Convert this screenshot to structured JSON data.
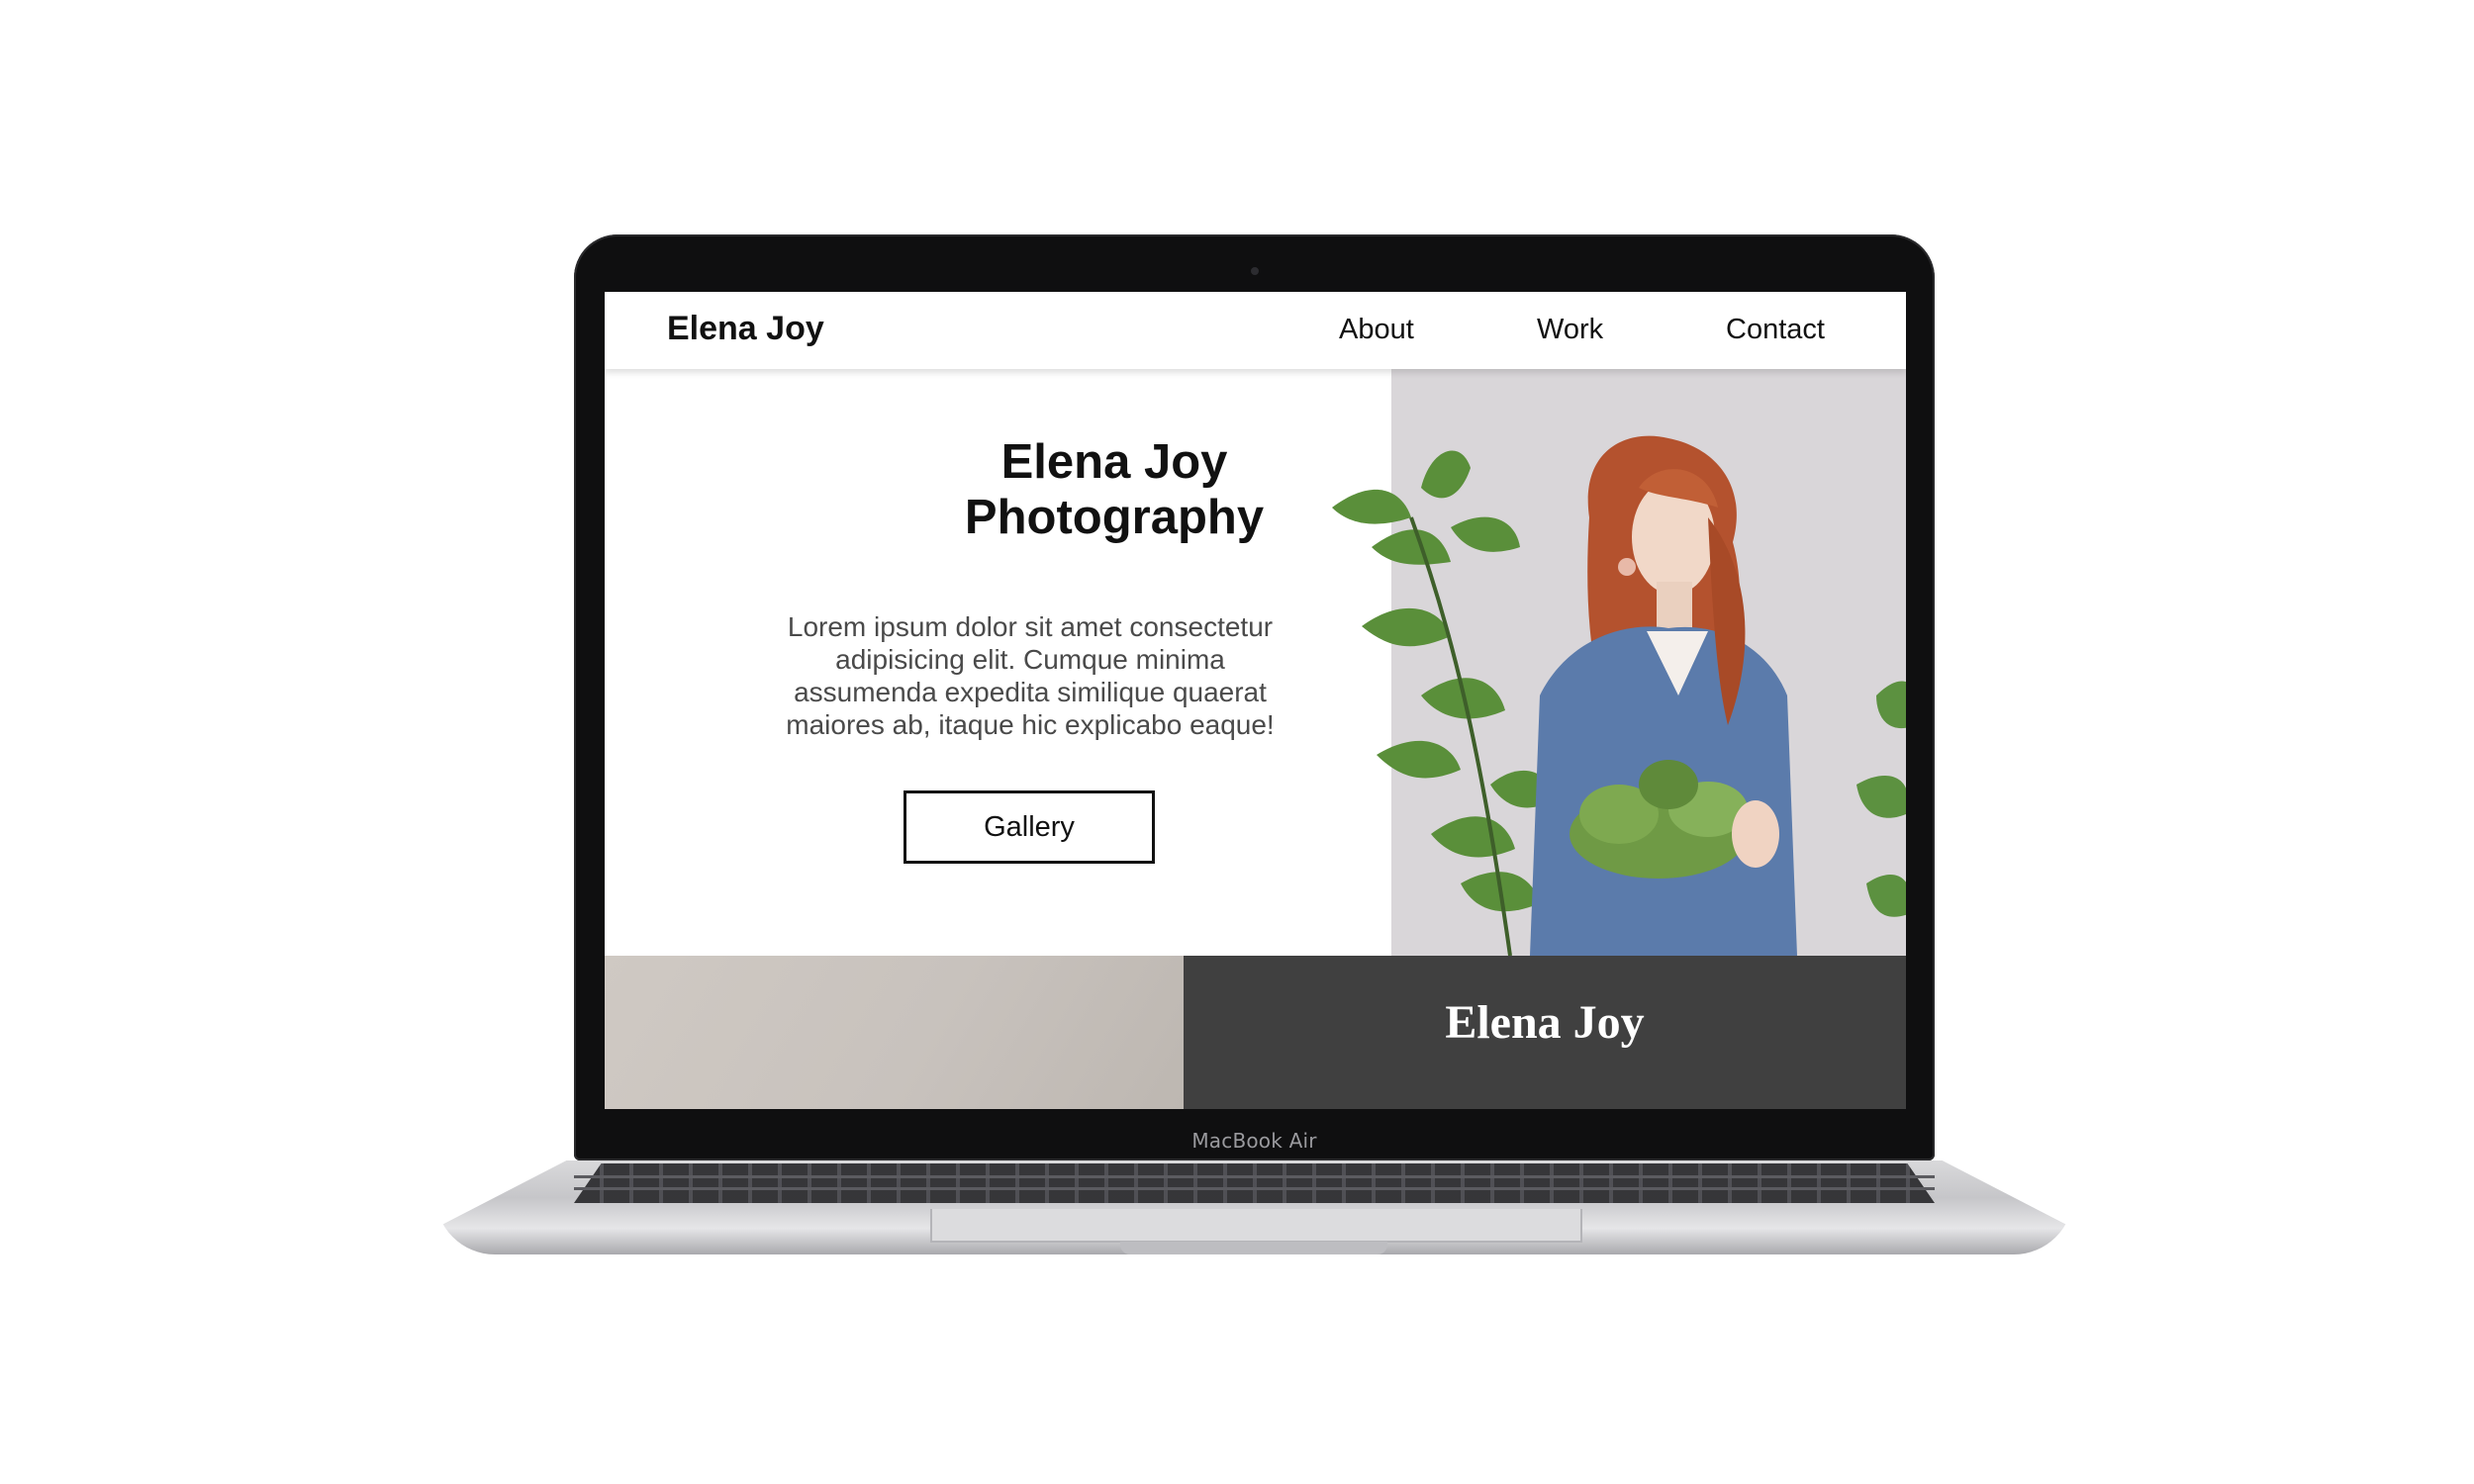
{
  "device": {
    "label": "MacBook Air"
  },
  "site": {
    "nav": {
      "brand": "Elena Joy",
      "links": [
        "About",
        "Work",
        "Contact"
      ]
    },
    "hero": {
      "title_line1": "Elena Joy",
      "title_line2": "Photography",
      "body": "Lorem ipsum dolor sit amet consectetur adipisicing elit. Cumque minima assumenda expedita similique quaerat maiores ab, itaque hic explicabo eaque!",
      "button_label": "Gallery"
    },
    "footer": {
      "brand": "Elena Joy"
    },
    "colors": {
      "accent_dark": "#404040",
      "photo_background": "#d9d6d9",
      "sweater": "#5b7bab",
      "hair": "#b4522e",
      "foliage": "#5a8f3a"
    }
  }
}
